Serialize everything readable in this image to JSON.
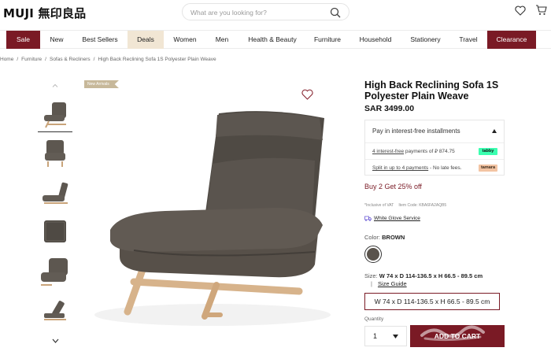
{
  "header": {
    "logo_latin": "MUJI",
    "logo_cjk": "無印良品",
    "search_placeholder": "What are you looking for?"
  },
  "nav": {
    "items": [
      {
        "label": "Sale",
        "style": "accent"
      },
      {
        "label": "New"
      },
      {
        "label": "Best Sellers"
      },
      {
        "label": "Deals",
        "style": "highlight"
      },
      {
        "label": "Women"
      },
      {
        "label": "Men"
      },
      {
        "label": "Health & Beauty"
      },
      {
        "label": "Furniture"
      },
      {
        "label": "Household"
      },
      {
        "label": "Stationery"
      },
      {
        "label": "Travel"
      },
      {
        "label": "Clearance",
        "style": "accent"
      }
    ]
  },
  "breadcrumb": [
    "Home",
    "Furniture",
    "Sofas & Recliners",
    "High Back Reclining Sofa 1S Polyester Plain Weave"
  ],
  "gallery": {
    "badge": "New Arrivals",
    "thumbnail_count": 6,
    "active_thumbnail": 1
  },
  "product": {
    "title": "High Back Reclining Sofa 1S Polyester Plain Weave",
    "price": "SAR 3499.00",
    "installments": {
      "heading": "Pay in interest-free installments",
      "tabby_text_link": "4 interest-free",
      "tabby_text_rest": " payments of ",
      "tabby_amount": "874.75",
      "tabby_logo": "tabby",
      "tamara_text_link": "Split in up to 4 payments",
      "tamara_text_rest": " - No late fees.",
      "tamara_logo": "tamara"
    },
    "promo": "Buy 2 Get 25% off",
    "vat_note": "*Inclusive of VAT",
    "item_code": "Item Code: KBA6FA2AQB5",
    "white_glove": "White Glove Service",
    "color_label": "Color:",
    "color_value": "BROWN",
    "size_label": "Size:",
    "size_value": "W 74 x D 114-136.5 x H 66.5 - 89.5 cm",
    "size_guide_pipe": "|",
    "size_guide": "Size Guide",
    "size_option": "W 74 x D 114-136.5 x H 66.5 - 89.5 cm",
    "quantity_label": "Quantity",
    "quantity_value": "1",
    "add_to_cart": "ADD TO CART"
  },
  "colors": {
    "accent": "#7a1a25",
    "deals_bg": "#f1e6d4",
    "swatch_brown": "#5a534c",
    "tabby": "#3bffb0",
    "tamara": "#f3c4a3"
  },
  "icons": [
    "search-icon",
    "heart-icon",
    "cart-icon",
    "chevron-up-icon",
    "chevron-down-icon",
    "caret-up-icon",
    "caret-down-icon",
    "truck-icon"
  ]
}
